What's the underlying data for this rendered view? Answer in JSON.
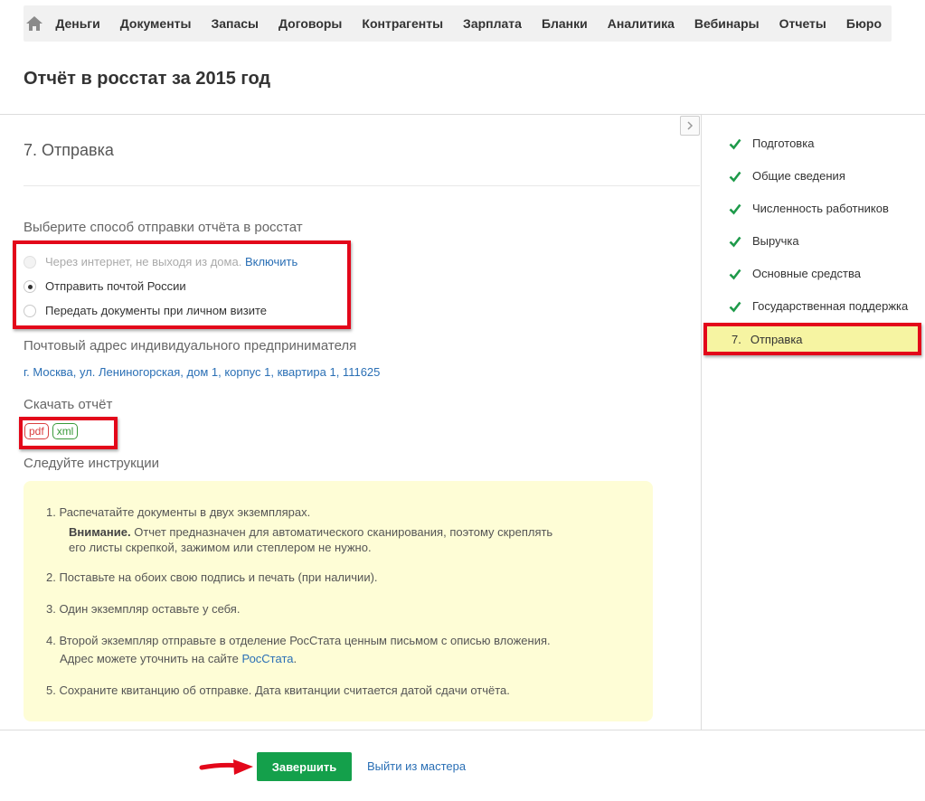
{
  "nav": {
    "items": [
      "Деньги",
      "Документы",
      "Запасы",
      "Договоры",
      "Контрагенты",
      "Зарплата",
      "Бланки",
      "Аналитика",
      "Вебинары",
      "Отчеты",
      "Бюро"
    ]
  },
  "page": {
    "title": "Отчёт в росстат за 2015 год"
  },
  "step": {
    "title": "7. Отправка"
  },
  "send_method": {
    "label": "Выберите способ отправки отчёта в росстат",
    "options": [
      {
        "label": "Через интернет, не выходя из дома.",
        "link": "Включить",
        "state": "disabled"
      },
      {
        "label": "Отправить почтой России",
        "state": "checked"
      },
      {
        "label": "Передать документы при личном визите",
        "state": "unchecked"
      }
    ]
  },
  "address": {
    "label": "Почтовый адрес индивидуального предпринимателя",
    "value": "г. Москва, ул. Лениногорская, дом 1, корпус 1, квартира 1, 111625"
  },
  "download": {
    "label": "Скачать отчёт",
    "formats": [
      "pdf",
      "xml"
    ]
  },
  "instructions": {
    "label": "Следуйте инструкции",
    "items": [
      {
        "text": "1. Распечатайте документы в двух экземплярах.",
        "note_bold": "Внимание.",
        "note_line1": " Отчет предназначен для автоматического сканирования, поэтому скреплять",
        "note_line2": "его листы скрепкой, зажимом или степлером не нужно."
      },
      {
        "text": "2. Поставьте на обоих свою подпись и печать (при наличии)."
      },
      {
        "text": "3. Один экземпляр оставьте у себя."
      },
      {
        "text": "4. Второй экземпляр отправьте в отделение РосСтата ценным письмом с описью вложения.",
        "line2_prefix": "Адрес можете уточнить на сайте ",
        "line2_link": "РосСтата",
        "line2_suffix": "."
      },
      {
        "text": "5. Сохраните квитанцию об отправке. Дата квитанции считается датой сдачи отчёта."
      }
    ]
  },
  "sidebar": {
    "done_steps": [
      "Подготовка",
      "Общие сведения",
      "Численность работников",
      "Выручка",
      "Основные средства",
      "Государственная поддержка"
    ],
    "active_step": {
      "number": "7.",
      "label": "Отправка"
    }
  },
  "footer": {
    "finish_label": "Завершить",
    "exit_label": "Выйти из мастера"
  },
  "colors": {
    "accent_green": "#14a04b",
    "link_blue": "#2a6fb5",
    "highlight_red": "#e3071a",
    "active_step_bg": "#f6f4a2",
    "instructions_bg": "#fefdd6"
  }
}
